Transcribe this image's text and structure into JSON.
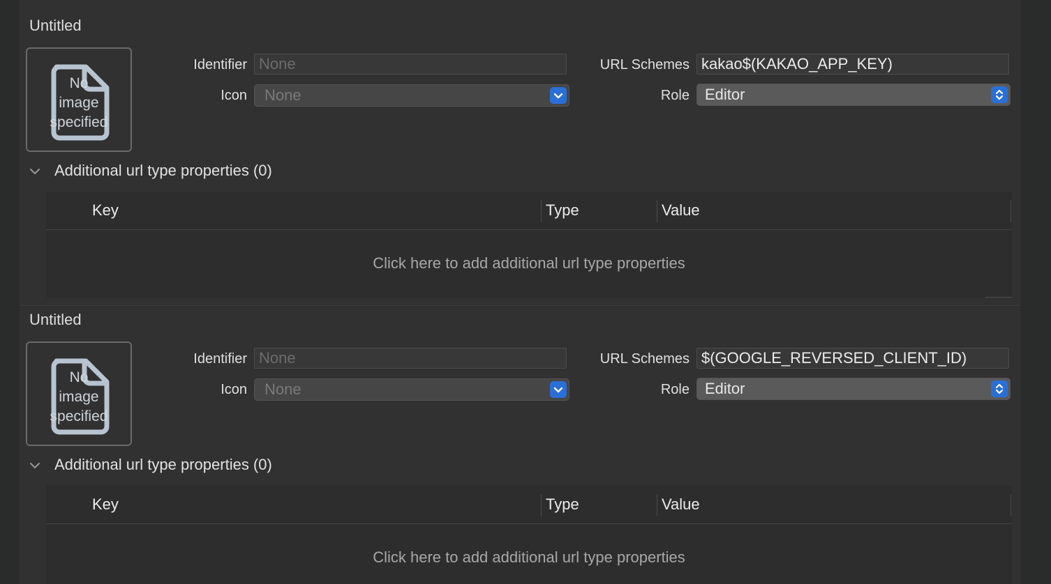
{
  "url_types": [
    {
      "title": "Untitled",
      "image_placeholder": [
        "No",
        "image",
        "specified"
      ],
      "identifier_label": "Identifier",
      "identifier_placeholder": "None",
      "icon_label": "Icon",
      "icon_value": "None",
      "url_schemes_label": "URL Schemes",
      "url_schemes_value": "kakao$(KAKAO_APP_KEY)",
      "role_label": "Role",
      "role_value": "Editor",
      "additional_label": "Additional url type properties (0)",
      "columns": [
        "Key",
        "Type",
        "Value"
      ],
      "empty_text": "Click here to add additional url type properties"
    },
    {
      "title": "Untitled",
      "image_placeholder": [
        "No",
        "image",
        "specified"
      ],
      "identifier_label": "Identifier",
      "identifier_placeholder": "None",
      "icon_label": "Icon",
      "icon_value": "None",
      "url_schemes_label": "URL Schemes",
      "url_schemes_value": "$(GOOGLE_REVERSED_CLIENT_ID)",
      "role_label": "Role",
      "role_value": "Editor",
      "additional_label": "Additional url type properties (0)",
      "columns": [
        "Key",
        "Type",
        "Value"
      ],
      "empty_text": "Click here to add additional url type properties"
    }
  ],
  "colors": {
    "background": "#2a2c2c",
    "panel": "#313131",
    "accent": "#2a6fd6"
  },
  "icons": [
    "document-icon",
    "chevron-down-icon",
    "popup-chevron-icon",
    "updown-chevron-icon",
    "disclosure-icon"
  ]
}
